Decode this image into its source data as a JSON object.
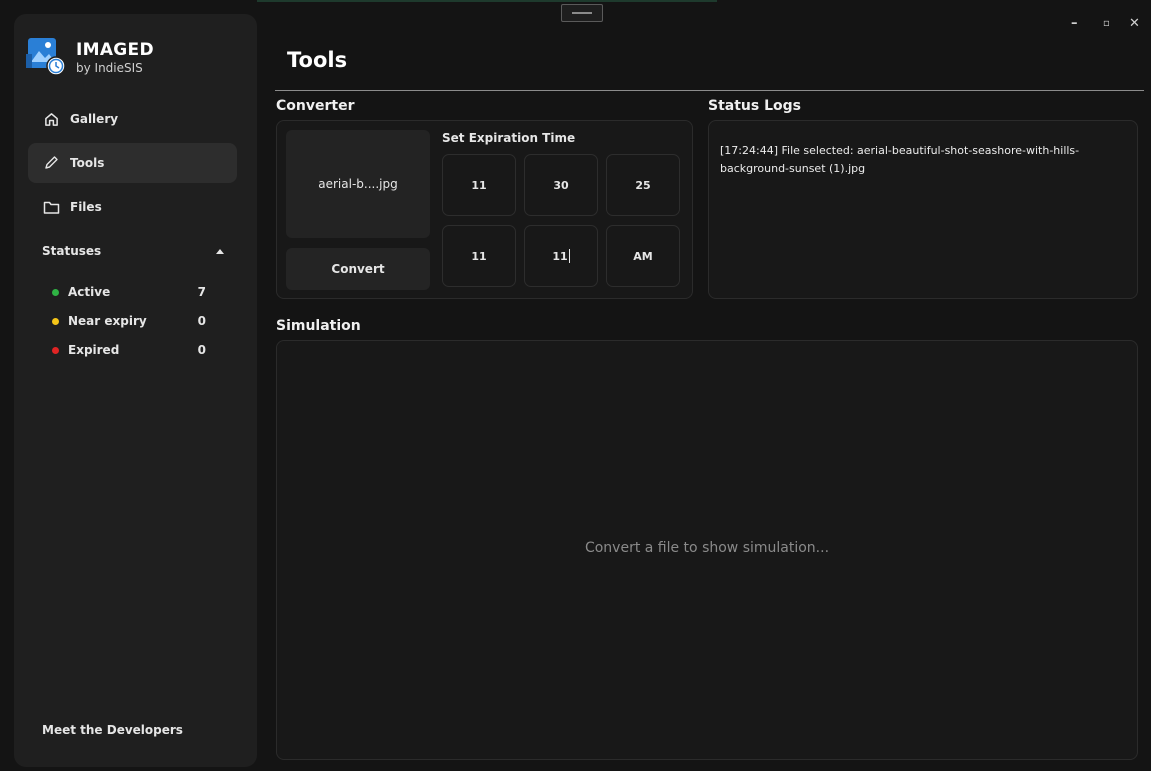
{
  "app": {
    "name": "IMAGED",
    "byline": "by IndieSIS"
  },
  "window_controls": {
    "minimize": "–",
    "maximize": "▫",
    "close": "✕"
  },
  "nav": [
    {
      "label": "Gallery",
      "icon": "home-icon",
      "active": false
    },
    {
      "label": "Tools",
      "icon": "pencil-icon",
      "active": true
    },
    {
      "label": "Files",
      "icon": "folder-icon",
      "active": false
    }
  ],
  "statuses": {
    "header": "Statuses",
    "items": [
      {
        "label": "Active",
        "count": "7",
        "color": "#2fb344"
      },
      {
        "label": "Near expiry",
        "count": "0",
        "color": "#f5c518"
      },
      {
        "label": "Expired",
        "count": "0",
        "color": "#e02424"
      }
    ]
  },
  "footer_link": "Meet the Developers",
  "page": {
    "title": "Tools"
  },
  "converter": {
    "label": "Converter",
    "file_name": "aerial-b....jpg",
    "convert_label": "Convert",
    "expiration_label": "Set Expiration Time",
    "time_fields": [
      "11",
      "30",
      "25",
      "11",
      "11",
      "AM"
    ]
  },
  "status_logs": {
    "label": "Status Logs",
    "entry": "[17:24:44] File selected: aerial-beautiful-shot-seashore-with-hills-background-sunset (1).jpg"
  },
  "simulation": {
    "label": "Simulation",
    "placeholder": "Convert a file to show simulation..."
  }
}
